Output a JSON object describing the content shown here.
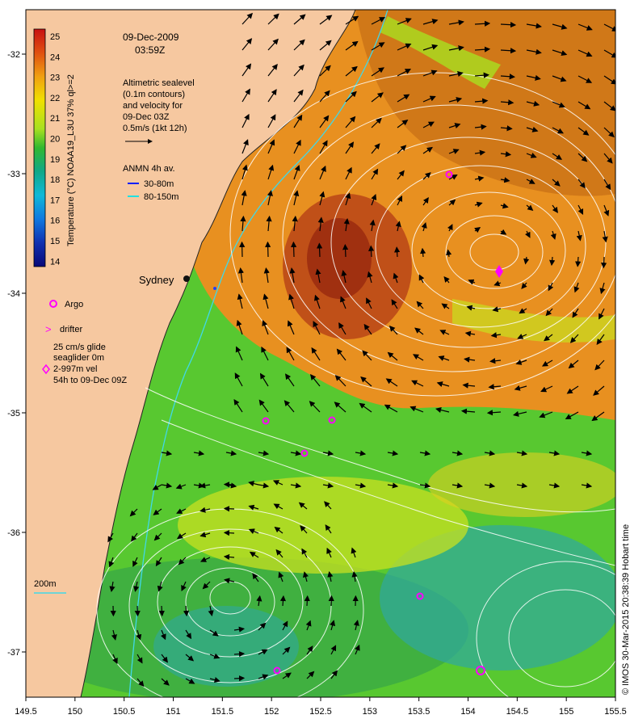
{
  "map": {
    "date": "09-Dec-2009",
    "time": "03:59Z",
    "altimetry": [
      "Altimetric sealevel",
      "(0.1m contours)",
      "and velocity for",
      "09-Dec 03Z",
      "0.5m/s (1kt 12h)"
    ],
    "anmn": {
      "title": "ANMN 4h av.",
      "shallow": "30-80m",
      "deep": "80-150m"
    },
    "city": "Sydney",
    "legend": {
      "argo": "Argo",
      "drifter": "drifter",
      "glider": [
        "25 cm/s glide",
        "seaglider 0m",
        "2-997m vel",
        "54h to 09-Dec 09Z"
      ],
      "depth": "200m"
    },
    "colorbar": {
      "label": "Temperature (°C) NOAA19_L3U 37% ql>=2",
      "ticks": [
        "25",
        "24",
        "23",
        "22",
        "21",
        "20",
        "19",
        "18",
        "17",
        "16",
        "15",
        "14"
      ]
    },
    "x_ticks": [
      "149.5",
      "150",
      "150.5",
      "151",
      "151.5",
      "152",
      "152.5",
      "153",
      "153.5",
      "154",
      "154.5",
      "155",
      "155.5"
    ],
    "y_ticks": [
      "-32",
      "-33",
      "-34",
      "-35",
      "-36",
      "-37"
    ],
    "credit": "© IMOS 30-Mar-2015 20:38:39 Hobart time",
    "colors": {
      "land": "#f6c8a0",
      "warm": "#e08a10",
      "hot": "#a83a10",
      "cool": "#58c830",
      "cold": "#2ab0a0",
      "argo": "#ff00ff"
    }
  }
}
